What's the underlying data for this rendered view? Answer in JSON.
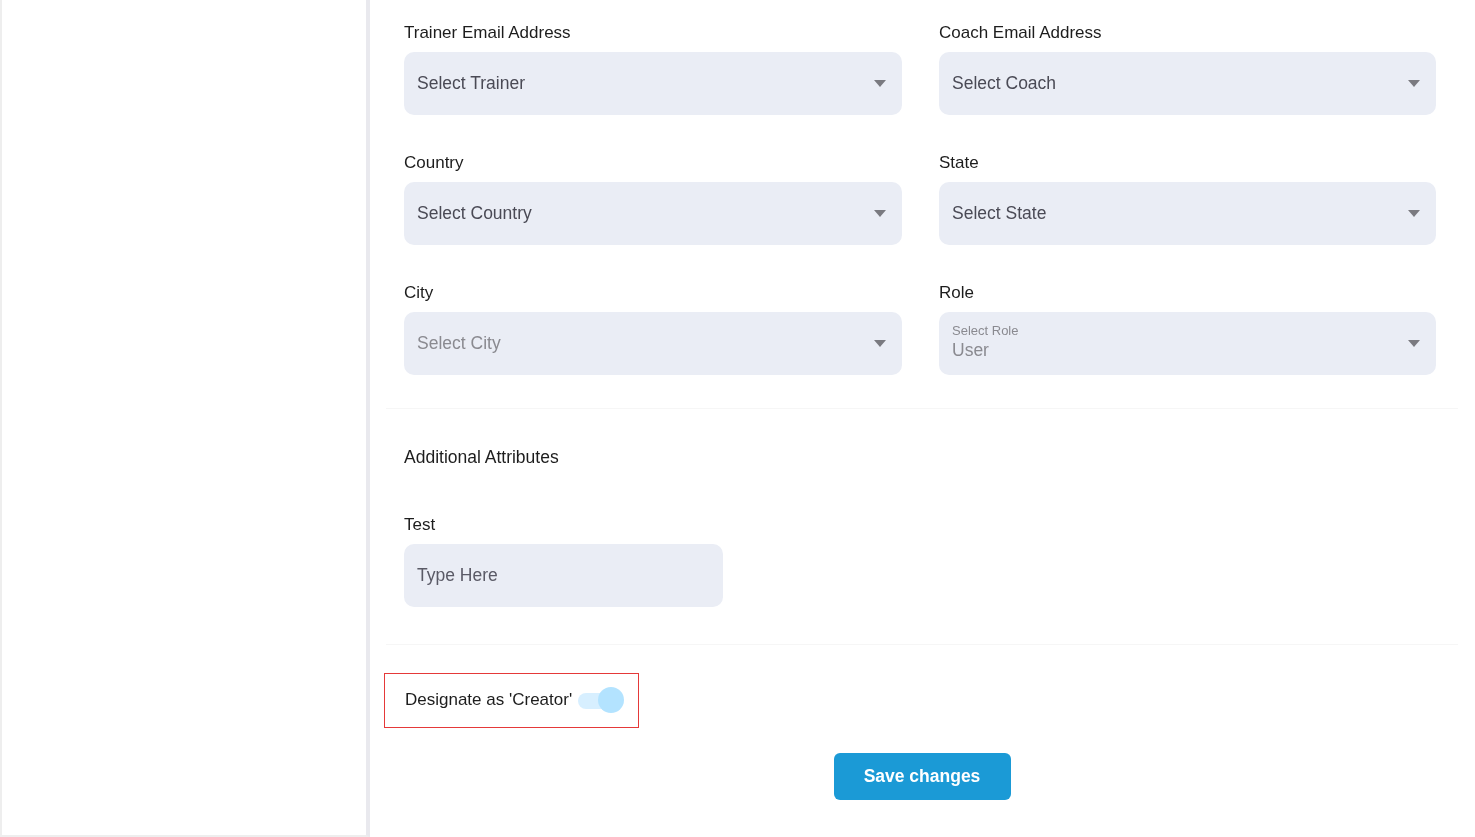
{
  "dropdowns": [
    {
      "label": "Trainer Email Address",
      "placeholder": "Select Trainer",
      "disabled": false
    },
    {
      "label": "Coach Email Address",
      "placeholder": "Select Coach",
      "disabled": false
    },
    {
      "label": "Country",
      "placeholder": "Select Country",
      "disabled": false
    },
    {
      "label": "State",
      "placeholder": "Select State",
      "disabled": false
    },
    {
      "label": "City",
      "placeholder": "Select City",
      "disabled": true
    },
    {
      "label": "Role",
      "floating_label": "Select Role",
      "value": "User",
      "disabled": true
    }
  ],
  "additional_attributes": {
    "title": "Additional Attributes",
    "fields": [
      {
        "label": "Test",
        "placeholder": "Type Here"
      }
    ]
  },
  "creator_toggle": {
    "label": "Designate as 'Creator'",
    "on": true,
    "highlighted": true
  },
  "save_button": "Save changes"
}
